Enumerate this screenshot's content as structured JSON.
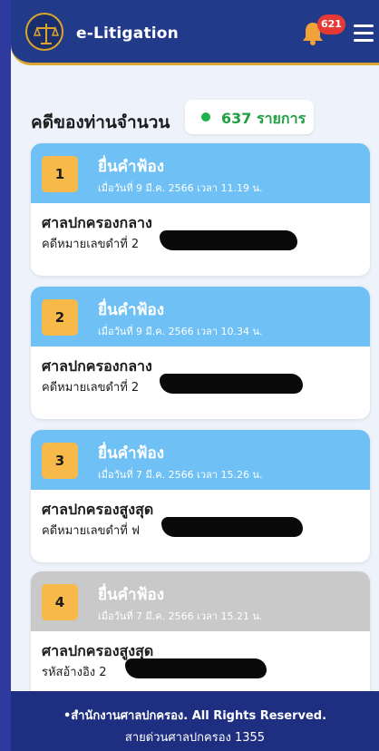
{
  "header": {
    "app_title": "e-Litigation",
    "notification_count": "621"
  },
  "summary": {
    "label": "คดีของท่านจำนวน",
    "count_text": "637 รายการ"
  },
  "cases": [
    {
      "number": "1",
      "type": "ยื่นคำฟ้อง",
      "date": "เมื่อวันที่ 9 มี.ค. 2566 เวลา 11.19 น.",
      "court": "ศาลปกครองกลาง",
      "ref_label": "คดีหมายเลขดำที่ 2"
    },
    {
      "number": "2",
      "type": "ยื่นคำฟ้อง",
      "date": "เมื่อวันที่ 9 มี.ค. 2566 เวลา 10.34 น.",
      "court": "ศาลปกครองกลาง",
      "ref_label": "คดีหมายเลขดำที่ 2"
    },
    {
      "number": "3",
      "type": "ยื่นคำฟ้อง",
      "date": "เมื่อวันที่ 7 มี.ค. 2566 เวลา 15.26 น.",
      "court": "ศาลปกครองสูงสุด",
      "ref_label": "คดีหมายเลขดำที่ ฟ"
    },
    {
      "number": "4",
      "type": "ยื่นคำฟ้อง",
      "date": "เมื่อวันที่ 7 มี.ค. 2566 เวลา 15.21 น.",
      "court": "ศาลปกครองสูงสุด",
      "ref_label": "รหัสอ้างอิง 2"
    }
  ],
  "footer": {
    "line1": "•สำนักงานศาลปกครอง. All Rights Reserved.",
    "line2": "สายด่วนศาลปกครอง 1355"
  },
  "colors": {
    "header_bg": "#213a8a",
    "accent_gold": "#d9a62b",
    "card_head_blue": "#6fc0f4",
    "card_head_gray": "#c9c9c9",
    "badge_red": "#e53935",
    "status_green": "#21b24b"
  }
}
